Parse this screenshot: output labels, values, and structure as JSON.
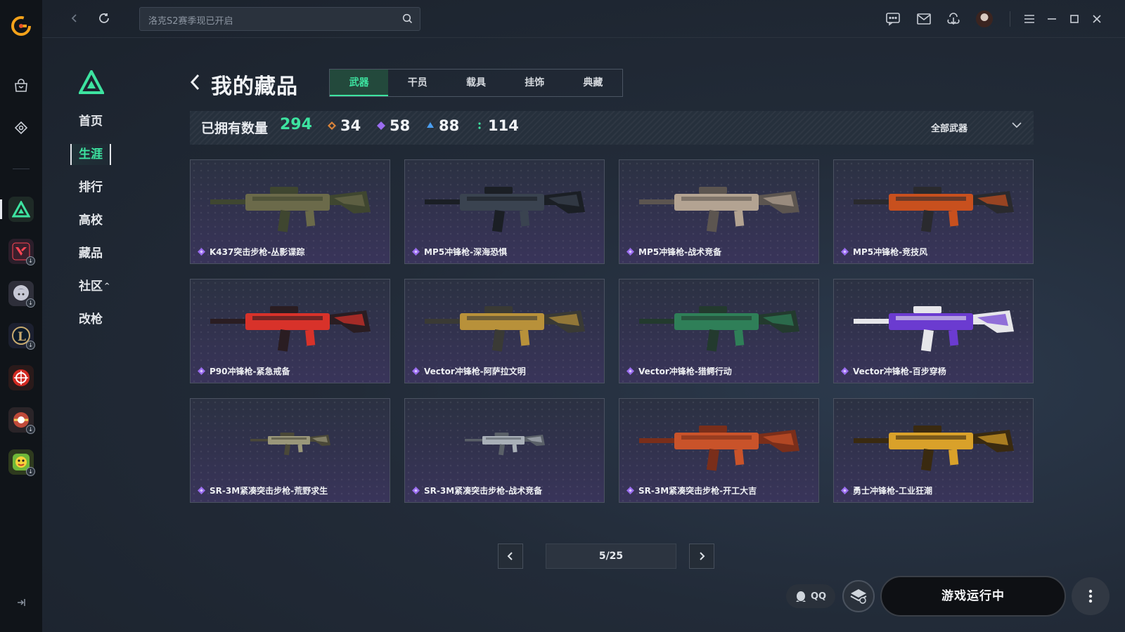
{
  "search": {
    "placeholder": "洛克S2赛季现已开启"
  },
  "nav": {
    "items": [
      {
        "label": "首页"
      },
      {
        "label": "生涯"
      },
      {
        "label": "排行"
      },
      {
        "label": "高校"
      },
      {
        "label": "藏品"
      },
      {
        "label": "社区",
        "caret": "^"
      },
      {
        "label": "改枪"
      }
    ],
    "active_index": 1
  },
  "header": {
    "title": "我的藏品",
    "tabs": [
      {
        "label": "武器",
        "active": true
      },
      {
        "label": "干员"
      },
      {
        "label": "载具"
      },
      {
        "label": "挂饰"
      },
      {
        "label": "典藏"
      }
    ]
  },
  "stats": {
    "owned_label": "已拥有数量",
    "owned_total": "294",
    "counts": [
      {
        "value": "34",
        "color": "#d9843a"
      },
      {
        "value": "58",
        "color": "#9a6cf0"
      },
      {
        "value": "88",
        "color": "#4a9ef0"
      },
      {
        "value": "114",
        "color": "#3de3a0"
      }
    ],
    "filter_label": "全部武器"
  },
  "items": [
    {
      "name": "K437突击步枪-丛影谍踪",
      "palette": [
        "#3f4630",
        "#6b6a4a"
      ]
    },
    {
      "name": "MP5冲锋枪-深海恐惧",
      "palette": [
        "#1b1f25",
        "#3a4350"
      ]
    },
    {
      "name": "MP5冲锋枪-战术竞备",
      "palette": [
        "#5c5550",
        "#b3a392"
      ]
    },
    {
      "name": "MP5冲锋枪-竞技风",
      "palette": [
        "#2a2a2e",
        "#c8501e"
      ]
    },
    {
      "name": "P90冲锋枪-紧急戒备",
      "palette": [
        "#2a1d22",
        "#d8322a"
      ]
    },
    {
      "name": "Vector冲锋枪-阿萨拉文明",
      "palette": [
        "#3a3a35",
        "#b8913a"
      ]
    },
    {
      "name": "Vector冲锋枪-猎鳄行动",
      "palette": [
        "#233a2e",
        "#2f7f58"
      ]
    },
    {
      "name": "Vector冲锋枪-百步穿杨",
      "palette": [
        "#e6e6ea",
        "#6b3bd0"
      ]
    },
    {
      "name": "SR-3M紧凑突击步枪-荒野求生",
      "palette": [
        "#4a4838",
        "#9a977a"
      ]
    },
    {
      "name": "SR-3M紧凑突击步枪-战术竞备",
      "palette": [
        "#5a6068",
        "#a9b0b8"
      ]
    },
    {
      "name": "SR-3M紧凑突击步枪-开工大吉",
      "palette": [
        "#7a2e1a",
        "#c9532a"
      ]
    },
    {
      "name": "勇士冲锋枪-工业狂潮",
      "palette": [
        "#3a2a10",
        "#d9a12a"
      ]
    }
  ],
  "pager": {
    "page_text": "5/25"
  },
  "bottom": {
    "qq_label": "QQ",
    "launch_label": "游戏运行中"
  },
  "colors": {
    "accent": "#3de3a0",
    "rarity_purple": "#9a6cf0"
  }
}
